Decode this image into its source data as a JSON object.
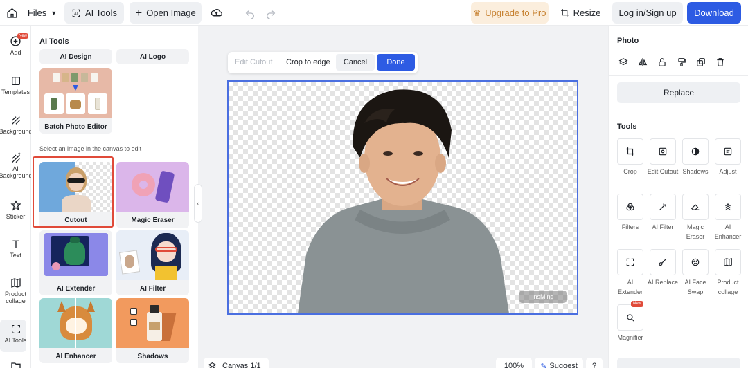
{
  "topbar": {
    "files_label": "Files",
    "ai_tools_label": "AI Tools",
    "open_image_label": "Open Image",
    "upgrade_label": "Upgrade to Pro",
    "resize_label": "Resize",
    "login_label": "Log in/Sign up",
    "download_label": "Download"
  },
  "rail": {
    "new_badge": "New",
    "items": [
      {
        "label": "Add"
      },
      {
        "label": "Templates"
      },
      {
        "label": "Background"
      },
      {
        "label": "AI Background"
      },
      {
        "label": "Sticker"
      },
      {
        "label": "Text"
      },
      {
        "label": "Product collage"
      },
      {
        "label": "AI Tools"
      }
    ]
  },
  "panel": {
    "title": "AI Tools",
    "top_cards": [
      "AI Design",
      "AI Logo"
    ],
    "batch_label": "Batch Photo Editor",
    "hint": "Select an image in the canvas to edit",
    "cards": [
      "Cutout",
      "Magic Eraser",
      "AI Extender",
      "AI Filter",
      "AI Enhancer",
      "Shadows"
    ]
  },
  "editbar": {
    "edit_cutout": "Edit Cutout",
    "crop_to_edge": "Crop to edge",
    "cancel": "Cancel",
    "done": "Done"
  },
  "canvas": {
    "watermark": "insMind",
    "canvas_label": "Canvas 1/1",
    "zoom": "100%",
    "suggest": "Suggest",
    "help": "?"
  },
  "right": {
    "photo_title": "Photo",
    "replace_label": "Replace",
    "tools_title": "Tools",
    "new_badge": "New",
    "tools": [
      {
        "label": "Crop"
      },
      {
        "label": "Edit Cutout"
      },
      {
        "label": "Shadows"
      },
      {
        "label": "Adjust"
      },
      {
        "label": "Filters"
      },
      {
        "label": "AI Filter"
      },
      {
        "label": "Magic Eraser"
      },
      {
        "label": "AI Enhancer"
      },
      {
        "label": "AI Extender"
      },
      {
        "label": "AI Replace"
      },
      {
        "label": "AI Face Swap"
      },
      {
        "label": "Product collage"
      },
      {
        "label": "Magnifier"
      }
    ]
  },
  "colors": {
    "accent": "#2d5be3",
    "upgrade_bg": "#fbeedd",
    "upgrade_text": "#c6802f",
    "selection": "#e04a39"
  }
}
